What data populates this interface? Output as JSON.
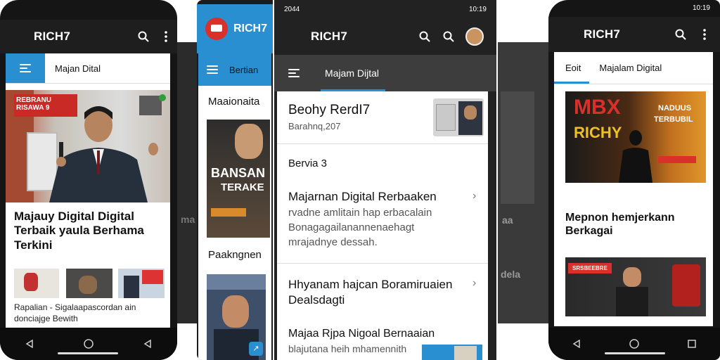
{
  "colors": {
    "accent": "#2a8fd0",
    "appbar": "#1e1e1e",
    "red_badge": "#d9302c",
    "nav": "#0d0d0d"
  },
  "phone1": {
    "app_title": "RICH7",
    "tab_label": "Majan Dital",
    "thumb_banner_text": "REBRANU RISAWA 9",
    "headline": "Majauy Digital Digital Terbaik yaula Berhama Terkini",
    "caption": "Rapalian - Sigalaapascordan ain donciajge Bewith"
  },
  "phone2": {
    "app_title": "RICH7",
    "tab_label": "Bertian",
    "section_1": "Maaionaita",
    "thumb_title_1": "BANSAN",
    "thumb_title_2": "TERAKE",
    "section_2": "Paakngnen"
  },
  "phone3": {
    "status_time": "2044",
    "status_battery": "10:19",
    "app_title": "RICH7",
    "tab_label": "Majam Dijtal",
    "card_title": "Beohy RerdI7",
    "card_subtitle": "Barahnq,207",
    "section_label": "Bervia 3",
    "item1_title": "Majarnan Digital Rerbaaken",
    "item1_body": "rvadne amlitain hap erbacalain Bonagagailanannenaehagt mrajadnye dessah.",
    "item2_title": "Hhyanam hajcan Boramiruaien Dealsdagti",
    "item3_title": "Majaa Rjpa Nigoal Bernaaian",
    "item3_body": "blajutana heih mhamennith"
  },
  "phone4": {
    "status_time": "10:19",
    "app_title": "RICH7",
    "tab_1": "Eoit",
    "tab_2": "Majalam Digital",
    "poster_title_1": "MBX",
    "poster_title_2": "RICHY",
    "poster_side_1": "NADUUS",
    "poster_side_2": "TERBUBIL",
    "headline": "Mepnon hemjerkann Berkagai",
    "video_badge": "SRSBEEBRE"
  },
  "background_captions": {
    "left_a": "ma",
    "right_a": "aa",
    "right_b": "dela"
  }
}
